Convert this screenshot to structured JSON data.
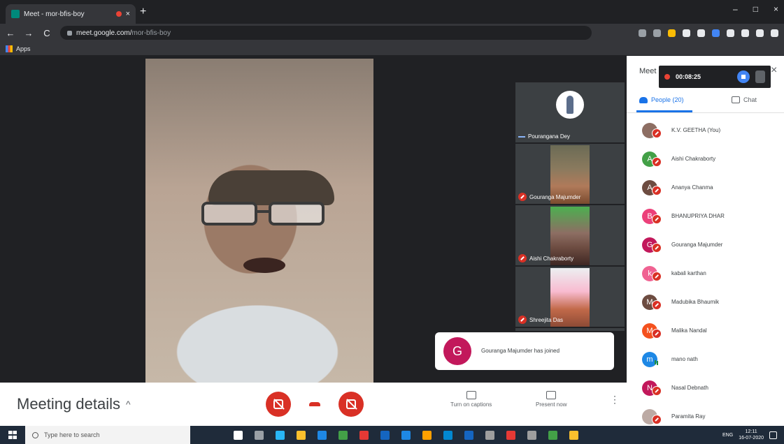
{
  "browser": {
    "tab_title": "Meet - mor-bfis-boy",
    "tab_close": "×",
    "new_tab": "+",
    "window_controls": [
      "–",
      "□",
      "×"
    ],
    "nav": {
      "back": "←",
      "forward": "→",
      "reload": "C"
    },
    "url_host": "meet.google.com/",
    "url_path": "mor-bfis-boy",
    "bookmarks_label": "Apps",
    "extension_colors": [
      "#9aa0a6",
      "#9aa0a6",
      "#fbbc04",
      "#e8eaed",
      "#e8eaed",
      "#4285f4",
      "#e8eaed",
      "#e8eaed",
      "#e8eaed",
      "#e8eaed"
    ]
  },
  "stage": {
    "tiles": [
      {
        "name": "Pourangana Dey",
        "kind": "avatar"
      },
      {
        "name": "Gouranga Majumder",
        "kind": "video"
      },
      {
        "name": "Aishi Chakraborty",
        "kind": "video"
      },
      {
        "name": "Shreejita Das",
        "kind": "video"
      }
    ],
    "toast": {
      "initial": "G",
      "message": "Gouranga Majumder has joined"
    }
  },
  "bottombar": {
    "meeting_details": "Meeting details",
    "meeting_details_caret": "^",
    "captions_label": "Turn on captions",
    "present_label": "Present now",
    "more": "⋮"
  },
  "panel": {
    "title": "Meet",
    "close": "×",
    "recording_time": "00:08:25",
    "people_tab": "People (20)",
    "chat_tab": "Chat",
    "people": [
      {
        "initial": "",
        "color": "#8d6e63",
        "name": "K.V. GEETHA (You)",
        "muted": true
      },
      {
        "initial": "A",
        "color": "#43a047",
        "name": "Aishi Chakraborty",
        "muted": true
      },
      {
        "initial": "A",
        "color": "#6d4c41",
        "name": "Ananya Chanma",
        "muted": true
      },
      {
        "initial": "B",
        "color": "#ec407a",
        "name": "BHANUPRIYA DHAR",
        "muted": true
      },
      {
        "initial": "G",
        "color": "#c2185b",
        "name": "Gouranga Majumder",
        "muted": true
      },
      {
        "initial": "k",
        "color": "#f06292",
        "name": "kabali karthan",
        "muted": true
      },
      {
        "initial": "M",
        "color": "#6d4c41",
        "name": "Madubika Bhaumik",
        "muted": true
      },
      {
        "initial": "M",
        "color": "#f4511e",
        "name": "Malika Nandal",
        "muted": true
      },
      {
        "initial": "m",
        "color": "#1e88e5",
        "name": "mano nath",
        "muted": false
      },
      {
        "initial": "N",
        "color": "#c2185b",
        "name": "Nasal Debnath",
        "muted": true
      },
      {
        "initial": "",
        "color": "#bcaaa4",
        "name": "Paramita Ray",
        "muted": true
      }
    ]
  },
  "taskbar": {
    "search_placeholder": "Type here to search",
    "icon_colors": [
      "#ffffff",
      "#9aa0a6",
      "#29b6f6",
      "#fbc02d",
      "#1e88e5",
      "#43a047",
      "#e53935",
      "#1565c0",
      "#1e88e5",
      "#ffa000",
      "#0288d1",
      "#1565c0",
      "#9e9e9e",
      "#e53935",
      "#9e9e9e",
      "#43a047",
      "#fbc02d"
    ],
    "language": "ENG",
    "time": "12:11",
    "date": "16-07-2020"
  }
}
